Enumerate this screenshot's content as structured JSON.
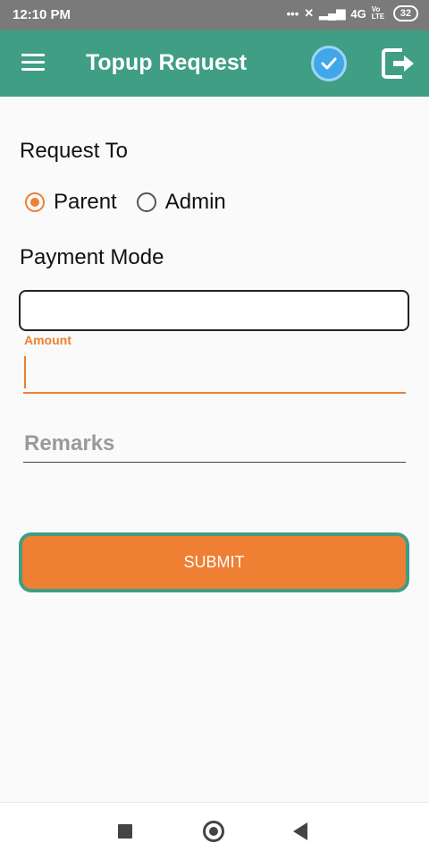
{
  "status_bar": {
    "time": "12:10 PM",
    "network": "4G",
    "carrier_badge": "Vo LTE",
    "battery": "32"
  },
  "app_bar": {
    "title": "Topup Request",
    "menu_icon": "hamburger-menu-icon",
    "verify_icon": "check-circle-icon",
    "logout_icon": "logout-icon",
    "color": "#3f9e83"
  },
  "form": {
    "request_to_label": "Request To",
    "request_options": [
      {
        "label": "Parent",
        "selected": true
      },
      {
        "label": "Admin",
        "selected": false
      }
    ],
    "payment_mode_label": "Payment Mode",
    "payment_mode_value": "",
    "amount_label": "Amount",
    "amount_value": "",
    "remarks_placeholder": "Remarks",
    "submit_label": "SUBMIT",
    "accent_color": "#ef7f32"
  },
  "nav_bar": {
    "recents_icon": "square-recents-icon",
    "home_icon": "circle-home-icon",
    "back_icon": "triangle-back-icon"
  }
}
